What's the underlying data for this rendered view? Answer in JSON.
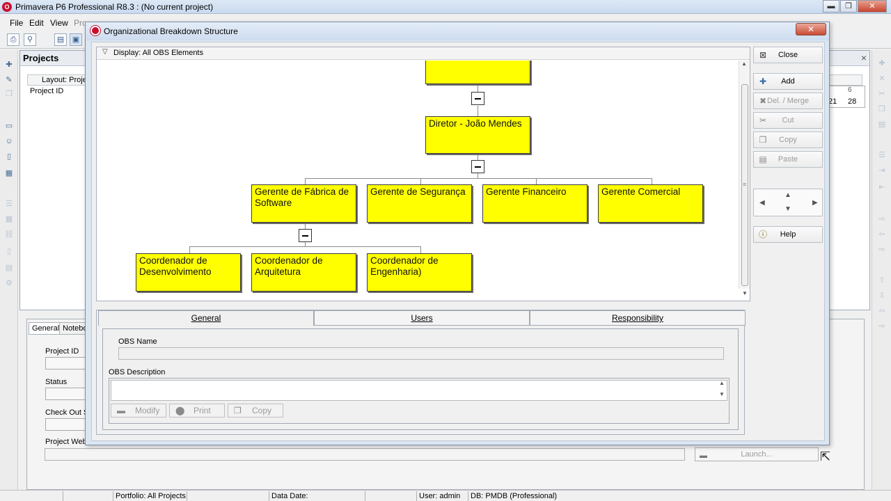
{
  "main_window": {
    "title": "Primavera P6 Professional R8.3 : (No current project)",
    "logo_glyph": "O",
    "minimize": "▬",
    "maximize": "❐",
    "close": "✕"
  },
  "menu": {
    "items": [
      {
        "label": "File"
      },
      {
        "label": "Edit"
      },
      {
        "label": "View"
      },
      {
        "label": "Pro"
      }
    ]
  },
  "projects_panel": {
    "title": "Projects",
    "close": "×",
    "layout_label": "Layout: Proje",
    "project_id_column": "Project ID",
    "gantt_week_1": "21",
    "gantt_week_2": "28",
    "gantt_month": "6"
  },
  "details_panel": {
    "tabs": [
      {
        "label": "General"
      },
      {
        "label": "Notebo"
      }
    ],
    "project_id_label": "Project ID",
    "status_label": "Status",
    "check_out_label": "Check Out S",
    "project_web_label": "Project Web",
    "launch_label": "Launch..."
  },
  "status_bar": {
    "portfolio": "Portfolio: All Projects",
    "data_date": "Data Date:",
    "user": "User: admin",
    "db": "DB: PMDB (Professional)"
  },
  "dialog": {
    "title": "Organizational Breakdown Structure",
    "close_glyph": "✕",
    "display_label": "Display: All OBS Elements",
    "display_chevron": "▽",
    "obs_nodes": [
      {
        "id": "top",
        "label": ""
      },
      {
        "id": "director",
        "label": "Diretor - João Mendes"
      },
      {
        "id": "software-factory",
        "label": "Gerente de Fábrica de Software"
      },
      {
        "id": "security",
        "label": "Gerente de Segurança"
      },
      {
        "id": "finance",
        "label": "Gerente Financeiro"
      },
      {
        "id": "commercial",
        "label": "Gerente Comercial"
      },
      {
        "id": "dev-coordinator",
        "label": "Coordenador de Desenvolvimento"
      },
      {
        "id": "architecture-coordinator",
        "label": "Coordenador de Arquitetura"
      },
      {
        "id": "engineering-coordinator",
        "label": "Coordenador de Engenharia)"
      }
    ],
    "buttons": {
      "close": "Close",
      "add": "Add",
      "delete_merge": "Del. / Merge",
      "cut": "Cut",
      "copy": "Copy",
      "paste": "Paste",
      "help": "Help"
    },
    "tabs": [
      {
        "label": "General",
        "active": true
      },
      {
        "label": "Users",
        "active": false
      },
      {
        "label": "Responsibility",
        "active": false
      }
    ],
    "general": {
      "obs_name_label": "OBS Name",
      "obs_name_value": "",
      "obs_description_label": "OBS Description",
      "obs_description_value": "",
      "modify_label": "Modify",
      "print_label": "Print",
      "copy_label": "Copy"
    }
  },
  "colors": {
    "node_fill": "#ffff00",
    "dialog_frame": "#dbe6f3",
    "close_red": "#c84a32"
  }
}
